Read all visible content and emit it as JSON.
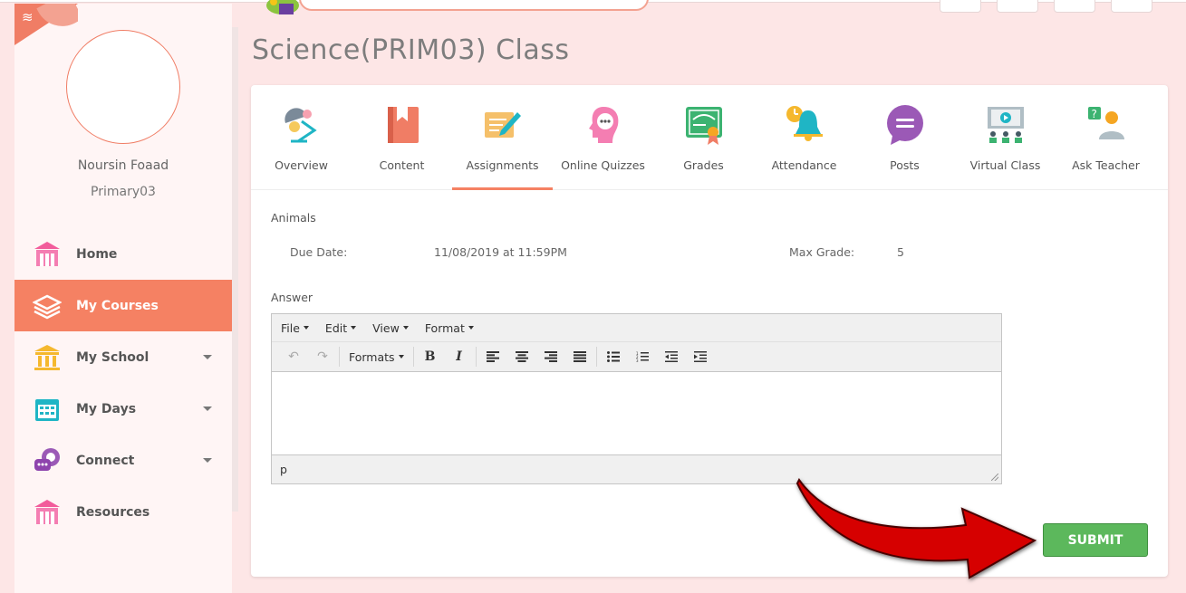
{
  "user": {
    "name": "Noursin Foaad",
    "class": "Primary03"
  },
  "nav": [
    {
      "label": "Home",
      "icon": "school-building-icon",
      "active": false
    },
    {
      "label": "My Courses",
      "icon": "book-stack-icon",
      "active": true
    },
    {
      "label": "My School",
      "icon": "bank-icon",
      "active": false,
      "expandable": true
    },
    {
      "label": "My Days",
      "icon": "calendar-icon",
      "active": false,
      "expandable": true
    },
    {
      "label": "Connect",
      "icon": "chat-bubble-icon",
      "active": false,
      "expandable": true
    },
    {
      "label": "Resources",
      "icon": "school-building-icon",
      "active": false
    }
  ],
  "page": {
    "title": "Science(PRIM03) Class"
  },
  "tabs": [
    {
      "label": "Overview",
      "icon": "desk-lamp-icon"
    },
    {
      "label": "Content",
      "icon": "book-icon"
    },
    {
      "label": "Assignments",
      "icon": "notepad-pen-icon",
      "active": true
    },
    {
      "label": "Online Quizzes",
      "icon": "head-thought-icon"
    },
    {
      "label": "Grades",
      "icon": "certificate-icon"
    },
    {
      "label": "Attendance",
      "icon": "bell-clock-icon"
    },
    {
      "label": "Posts",
      "icon": "speech-bubble-icon"
    },
    {
      "label": "Virtual Class",
      "icon": "presentation-icon"
    },
    {
      "label": "Ask Teacher",
      "icon": "question-person-icon"
    }
  ],
  "assignment": {
    "title": "Animals",
    "due_label": "Due Date:",
    "due_value": "11/08/2019 at 11:59PM",
    "max_grade_label": "Max Grade:",
    "max_grade_value": "5",
    "answer_label": "Answer"
  },
  "editor": {
    "menus": [
      "File",
      "Edit",
      "View",
      "Format"
    ],
    "formats_label": "Formats",
    "status_path": "p"
  },
  "submit_label": "SUBMIT",
  "colors": {
    "accent": "#f58163",
    "submit": "#5cb85c",
    "arrow": "#d60000"
  }
}
